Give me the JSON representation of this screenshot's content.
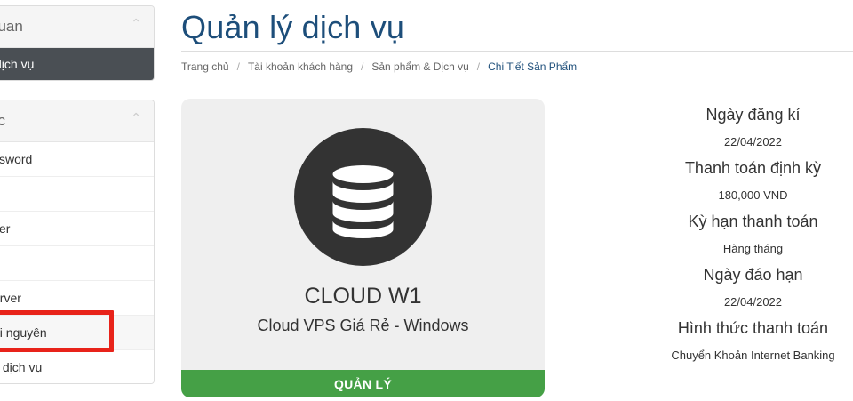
{
  "sidebar": {
    "panel1": {
      "title": "quan",
      "active_item": "dịch vụ"
    },
    "panel2": {
      "title": "ác",
      "items": [
        "ssword",
        "",
        "ver",
        "",
        "erver",
        "ài nguyên",
        "y dịch vụ"
      ]
    }
  },
  "page": {
    "title": "Quản lý dịch vụ"
  },
  "breadcrumb": {
    "items": [
      "Trang chủ",
      "Tài khoản khách hàng",
      "Sản phẩm & Dịch vụ"
    ],
    "current": "Chi Tiết Sản Phẩm",
    "separator": "/"
  },
  "product": {
    "icon": "database-icon",
    "name": "CLOUD W1",
    "description": "Cloud VPS Giá Rẻ - Windows",
    "manage_label": "QUẢN LÝ"
  },
  "details": [
    {
      "label": "Ngày đăng kí",
      "value": "22/04/2022"
    },
    {
      "label": "Thanh toán định kỳ",
      "value": "180,000 VND"
    },
    {
      "label": "Kỳ hạn thanh toán",
      "value": "Hàng tháng"
    },
    {
      "label": "Ngày đáo hạn",
      "value": "22/04/2022"
    },
    {
      "label": "Hình thức thanh toán",
      "value": "Chuyển Khoản Internet Banking"
    }
  ],
  "colors": {
    "accent": "#1d4e7a",
    "active_bg": "#4a4f54",
    "manage_button": "#45a046",
    "highlight": "#e8231a"
  }
}
